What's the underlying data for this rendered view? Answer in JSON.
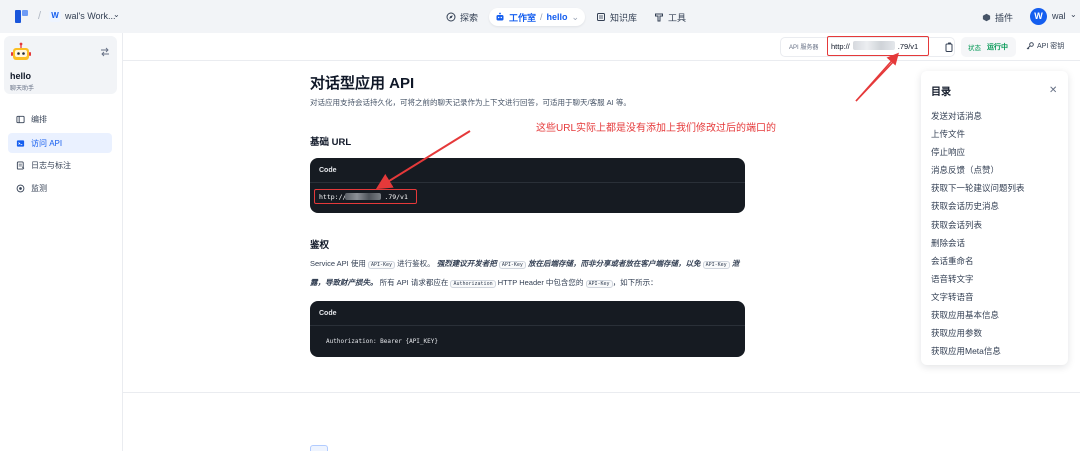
{
  "topnav": {
    "workspace_badge": "W",
    "workspace_name": "wal's Work...",
    "explore": "探索",
    "studio": "工作室",
    "studio_app": "hello",
    "knowledge": "知识库",
    "tools": "工具",
    "plugins": "插件",
    "user_initial": "W",
    "user_name": "wal"
  },
  "sidebar": {
    "app_name": "hello",
    "app_type": "聊天助手",
    "items": [
      {
        "label": "编排"
      },
      {
        "label": "访问 API"
      },
      {
        "label": "日志与标注"
      },
      {
        "label": "监测"
      }
    ]
  },
  "topbar": {
    "api_server_label": "API 服务器",
    "api_url_prefix": "http://",
    "api_url_suffix": ".79/v1",
    "status_label": "状态",
    "status_value": "运行中",
    "api_key_label": "API 密钥"
  },
  "doc": {
    "title": "对话型应用 API",
    "description": "对话应用支持会话持久化，可将之前的聊天记录作为上下文进行回答，可适用于聊天/客服 AI 等。",
    "annotation": "这些URL实际上都是没有添加上我们修改过后的端口的",
    "base_url_heading": "基础 URL",
    "code_label": "Code",
    "base_url_prefix": "http://",
    "base_url_suffix": ".79/v1",
    "auth_heading": "鉴权",
    "auth_p1": "Service API 使用",
    "auth_code_key": "API-Key",
    "auth_p2": "进行鉴权。",
    "auth_strong1": "强烈建议开发者把",
    "auth_strong2": "放在后端存储，而非分享或者放在客户端存储，以免",
    "auth_strong3": "泄露，导致财产损失。",
    "auth_p3": "所有 API 请求都应在",
    "auth_code_header": "Authorization",
    "auth_p4": "HTTP Header 中包含您的",
    "auth_p5": "，如下所示：",
    "auth_code_line": "Authorization: Bearer {API_KEY}"
  },
  "toc": {
    "title": "目录",
    "items": [
      "发送对话消息",
      "上传文件",
      "停止响应",
      "消息反馈（点赞）",
      "获取下一轮建议问题列表",
      "获取会话历史消息",
      "获取会话列表",
      "删除会话",
      "会话重命名",
      "语音转文字",
      "文字转语音",
      "获取应用基本信息",
      "获取应用参数",
      "获取应用Meta信息"
    ]
  },
  "colors": {
    "accent": "#155eef",
    "annotation_red": "#e5393a",
    "running_green": "#039855",
    "code_bg": "#161b22"
  }
}
